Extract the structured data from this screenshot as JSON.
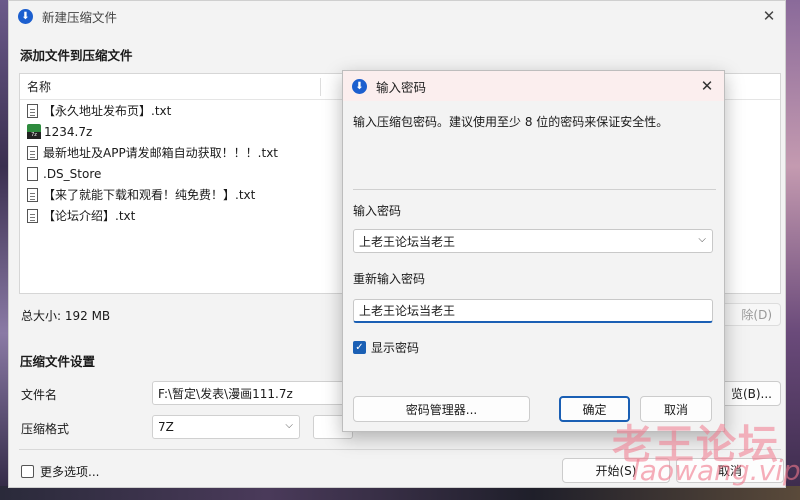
{
  "main_window": {
    "title": "新建压缩文件",
    "close_glyph": "✕",
    "section_add": "添加文件到压缩文件",
    "column_name": "名称",
    "files": [
      {
        "name": "【永久地址发布页】.txt",
        "icon": "txt-file-icon"
      },
      {
        "name": "1234.7z",
        "icon": "7z-archive-icon"
      },
      {
        "name": "最新地址及APP请发邮箱自动获取！！！.txt",
        "icon": "txt-file-icon"
      },
      {
        "name": ".DS_Store",
        "icon": "blank-file-icon"
      },
      {
        "name": "【来了就能下载和观看！纯免费！】.txt",
        "icon": "txt-file-icon"
      },
      {
        "name": "【论坛介绍】.txt",
        "icon": "txt-file-icon"
      }
    ],
    "total_size": "总大小: 192 MB",
    "remove_button": "除(D)",
    "section_settings": "压缩文件设置",
    "filename_label": "文件名",
    "filename_value": "F:\\暂定\\发表\\漫画111.7z",
    "browse_button": "览(B)...",
    "format_label": "压缩格式",
    "format_value": "7Z",
    "more_options": "更多选项...",
    "start_button": "开始(S)",
    "cancel_button": "取消"
  },
  "dialog": {
    "title": "输入密码",
    "close_glyph": "✕",
    "description": "输入压缩包密码。建议使用至少 8 位的密码来保证安全性。",
    "password_label": "输入密码",
    "password_value": "上老王论坛当老王",
    "reenter_label": "重新输入密码",
    "reenter_value": "上老王论坛当老王",
    "show_password": "显示密码",
    "show_password_checked": true,
    "manager_button": "密码管理器...",
    "ok_button": "确定",
    "cancel_button": "取消"
  },
  "watermark": {
    "line1": "老王论坛",
    "line2": "laowang.vip"
  },
  "colors": {
    "accent": "#1a5fb4",
    "dialog_titlebar": "#fbeeee",
    "watermark": "#f0788c"
  }
}
